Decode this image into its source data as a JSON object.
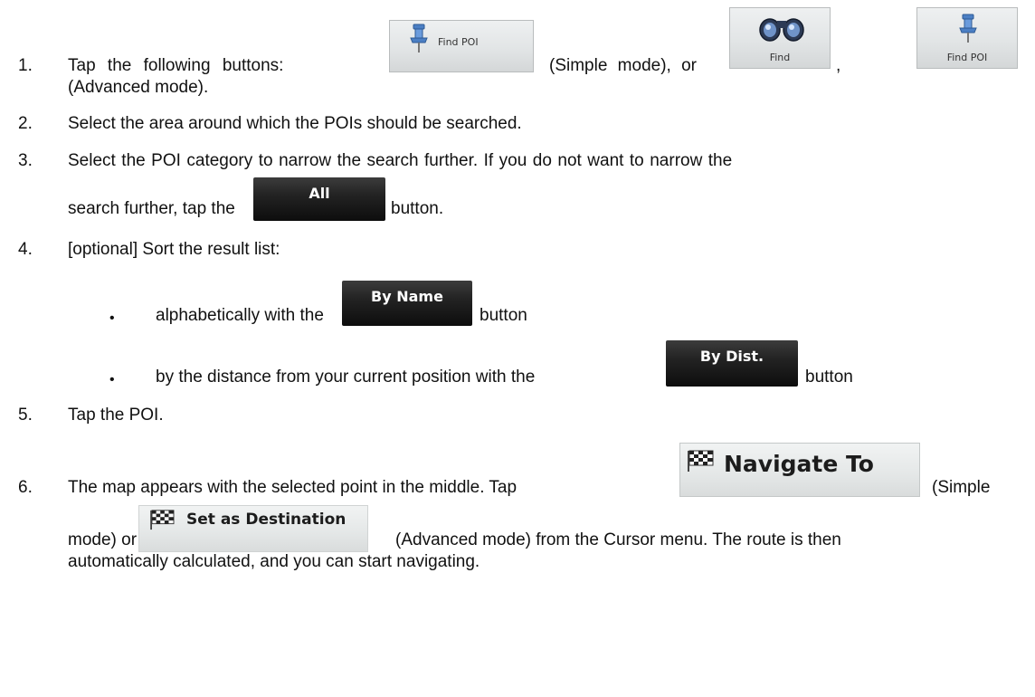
{
  "steps": {
    "s1": {
      "number": "1.",
      "text_a": "Tap the following buttons:",
      "text_b": "(Simple mode), or",
      "comma": ",",
      "text_c": "(Advanced mode)."
    },
    "s2": {
      "number": "2.",
      "text": "Select the area around which the POIs should be searched."
    },
    "s3": {
      "number": "3.",
      "text_a": "Select the POI category to narrow the search further. If you do not want to narrow the",
      "text_b": "search further, tap the",
      "text_c": "button."
    },
    "s4": {
      "number": "4.",
      "text": "[optional] Sort the result list:",
      "bullet1_a": "alphabetically with the",
      "bullet1_b": "button",
      "bullet2_a": "by the distance from your current position with the",
      "bullet2_b": "button",
      "bullet_char": "•"
    },
    "s5": {
      "number": "5.",
      "text": "Tap the POI."
    },
    "s6": {
      "number": "6.",
      "text_a": "The map appears with the selected point in the middle. Tap",
      "text_b": "(Simple",
      "text_c": "mode) or",
      "text_d": "(Advanced mode) from the Cursor menu. The route is then",
      "text_e": "automatically calculated, and you can start navigating."
    }
  },
  "buttons": {
    "find_poi_simple": "Find POI",
    "find": "Find",
    "find_poi_advanced": "Find POI",
    "all": "All",
    "by_name": "By Name",
    "by_dist": "By Dist.",
    "navigate_to": "Navigate To",
    "set_as_destination": "Set as Destination"
  },
  "icons": {
    "pushpin": "pushpin-icon",
    "binoculars": "binoculars-icon",
    "checkered_flag": "checkered-flag-icon"
  }
}
